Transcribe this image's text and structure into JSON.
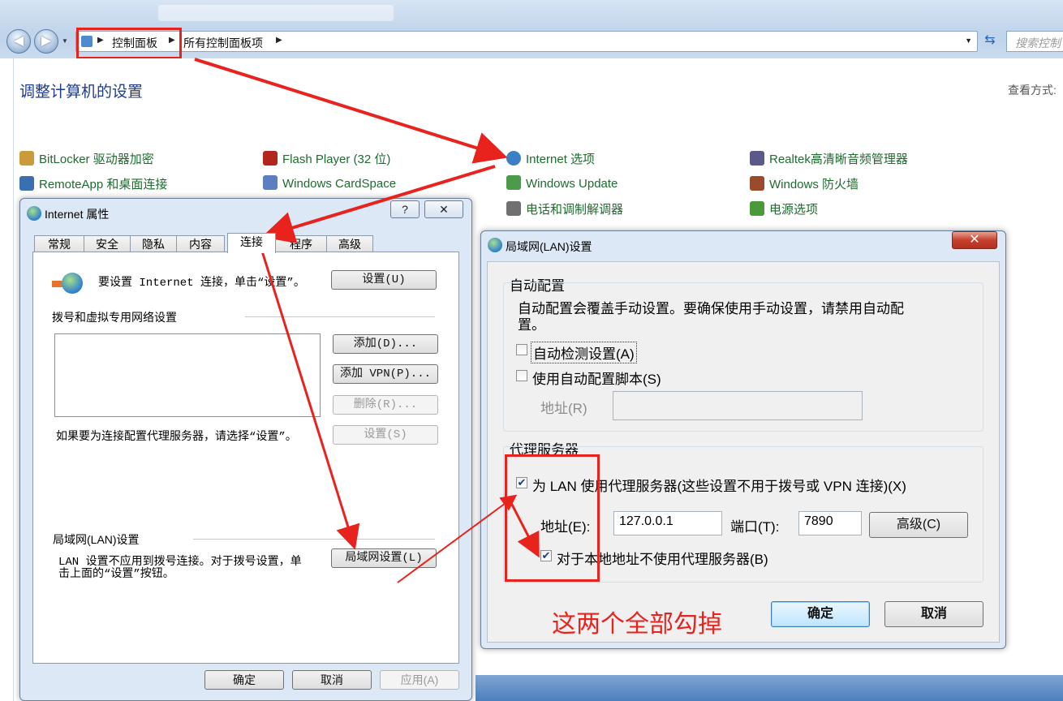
{
  "explorer": {
    "breadcrumb": [
      "控制面板",
      "所有控制面板项"
    ],
    "search_placeholder": "搜索控制",
    "page_title": "调整计算机的设置",
    "view_by_label": "查看方式:"
  },
  "control_panel_items": [
    {
      "label": "BitLocker 驱动器加密",
      "icon": "bitlocker-icon",
      "color": "#c99b3a"
    },
    {
      "label": "Flash Player (32 位)",
      "icon": "flash-icon",
      "color": "#b3261e"
    },
    {
      "label": "Internet 选项",
      "icon": "internet-options-icon",
      "color": "#3b7fc4"
    },
    {
      "label": "Realtek高清晰音频管理器",
      "icon": "audio-manager-icon",
      "color": "#5a5a8a"
    },
    {
      "label": "RemoteApp 和桌面连接",
      "icon": "remoteapp-icon",
      "color": "#3a6fb0"
    },
    {
      "label": "Windows CardSpace",
      "icon": "cardspace-icon",
      "color": "#5d7fbf"
    },
    {
      "label": "Windows Update",
      "icon": "windows-update-icon",
      "color": "#4b9b4b"
    },
    {
      "label": "Windows 防火墙",
      "icon": "firewall-icon",
      "color": "#9a4b2b"
    },
    {
      "label": "电话和调制解调器",
      "icon": "phone-modem-icon",
      "color": "#707070"
    },
    {
      "label": "电源选项",
      "icon": "power-options-icon",
      "color": "#4a9a3a"
    }
  ],
  "internet_properties": {
    "title": "Internet 属性",
    "help_glyph": "?",
    "close_glyph": "✕",
    "tabs": [
      "常规",
      "安全",
      "隐私",
      "内容",
      "连接",
      "程序",
      "高级"
    ],
    "active_tab": "连接",
    "setup_text": "要设置 Internet 连接，单击“设置”。",
    "setup_button": "设置(U)",
    "dialup_group": "拨号和虚拟专用网络设置",
    "add_button": "添加(D)...",
    "add_vpn_button": "添加 VPN(P)...",
    "remove_button": "删除(R)...",
    "settings_button": "设置(S)",
    "proxy_hint": "如果要为连接配置代理服务器，请选择“设置”。",
    "lan_group": "局域网(LAN)设置",
    "lan_text_1": "LAN 设置不应用到拨号连接。对于拨号设置，单",
    "lan_text_2": "击上面的“设置”按钮。",
    "lan_button": "局域网设置(L)",
    "ok_button": "确定",
    "cancel_button": "取消",
    "apply_button": "应用(A)"
  },
  "lan_settings": {
    "title": "局域网(LAN)设置",
    "close_glyph": "✕",
    "auto_config_group": "自动配置",
    "auto_config_desc_1": "自动配置会覆盖手动设置。要确保使用手动设置，请禁用自动配",
    "auto_config_desc_2": "置。",
    "auto_detect_label": "自动检测设置(A)",
    "auto_detect_checked": false,
    "auto_script_label": "使用自动配置脚本(S)",
    "auto_script_checked": false,
    "script_address_label": "地址(R)",
    "script_address_value": "",
    "proxy_group": "代理服务器",
    "use_proxy_label": "为 LAN 使用代理服务器(这些设置不用于拨号或 VPN 连接)(X)",
    "use_proxy_checked": true,
    "address_label": "地址(E):",
    "address_value": "127.0.0.1",
    "port_label": "端口(T):",
    "port_value": "7890",
    "advanced_button": "高级(C)",
    "bypass_local_label": "对于本地地址不使用代理服务器(B)",
    "bypass_local_checked": true,
    "ok_button": "确定",
    "cancel_button": "取消",
    "check_glyph": "✔"
  },
  "annotation": {
    "text": "这两个全部勾掉",
    "color": "#e8231d"
  }
}
